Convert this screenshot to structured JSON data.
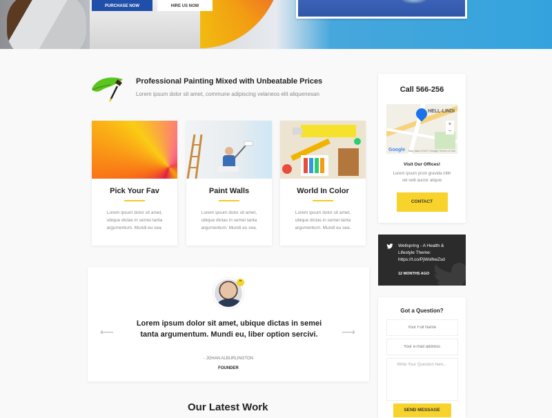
{
  "hero": {
    "primary_button": "PURCHASE NOW",
    "secondary_button": "HIRE US NOW"
  },
  "feature": {
    "title": "Professional Painting Mixed with Unbeatable Prices",
    "subtitle": "Lorem ipsum dolor sit amet, commune adipiscing velaneos elit aliquenesan"
  },
  "cards": [
    {
      "title": "Pick Your Fav",
      "text": "Lorem ipsum dolor sit amet, ubique dictas in semei tanta argumentum. Mundi eu sea."
    },
    {
      "title": "Paint Walls",
      "text": "Lorem ipsum dolor sit amet, ubique dictas in semei tanta argumentum. Mundi eu sea."
    },
    {
      "title": "World In Color",
      "text": "Lorem ipsum dolor sit amet, ubique dictas in semei tanta argumentum. Mundi eu sea."
    }
  ],
  "sidebar": {
    "call_title": "Call 566-256",
    "map_label": "HELL-LINDI",
    "map_google": "Google",
    "map_credit": "Map data ©2017 Google   Terms of Use",
    "visit_title": "Visit Our Offices!",
    "visit_text": "Lorem ipsum proin gravida nibh vel velit auctor aliquie",
    "contact_button": "CONTACT",
    "tweet_text": "Wellspring - A Health & Lifestyle Theme: https://t.co/PjWolhwZsd",
    "tweet_time": "12 MONTHS AGO",
    "question_title": "Got a Question?",
    "name_placeholder": "Your Full Name",
    "email_placeholder": "Your e-mail address",
    "question_placeholder": "Write Your Question here...",
    "send_button": "SEND MESSAGE"
  },
  "testimonial": {
    "quote": "Lorem ipsum dolor sit amet, ubique dictas in semei tanta argumentum. Mundi eu, liber option sercivi.",
    "author": "- JOHAN ALBURLINGTON",
    "role": "FOUNDER",
    "quote_mark": "”"
  },
  "latest_work_title": "Our Latest Work",
  "colors": {
    "accent_yellow": "#f7d32b",
    "primary_blue": "#1f4fa8",
    "dark_tweet": "#2b2b2b"
  }
}
